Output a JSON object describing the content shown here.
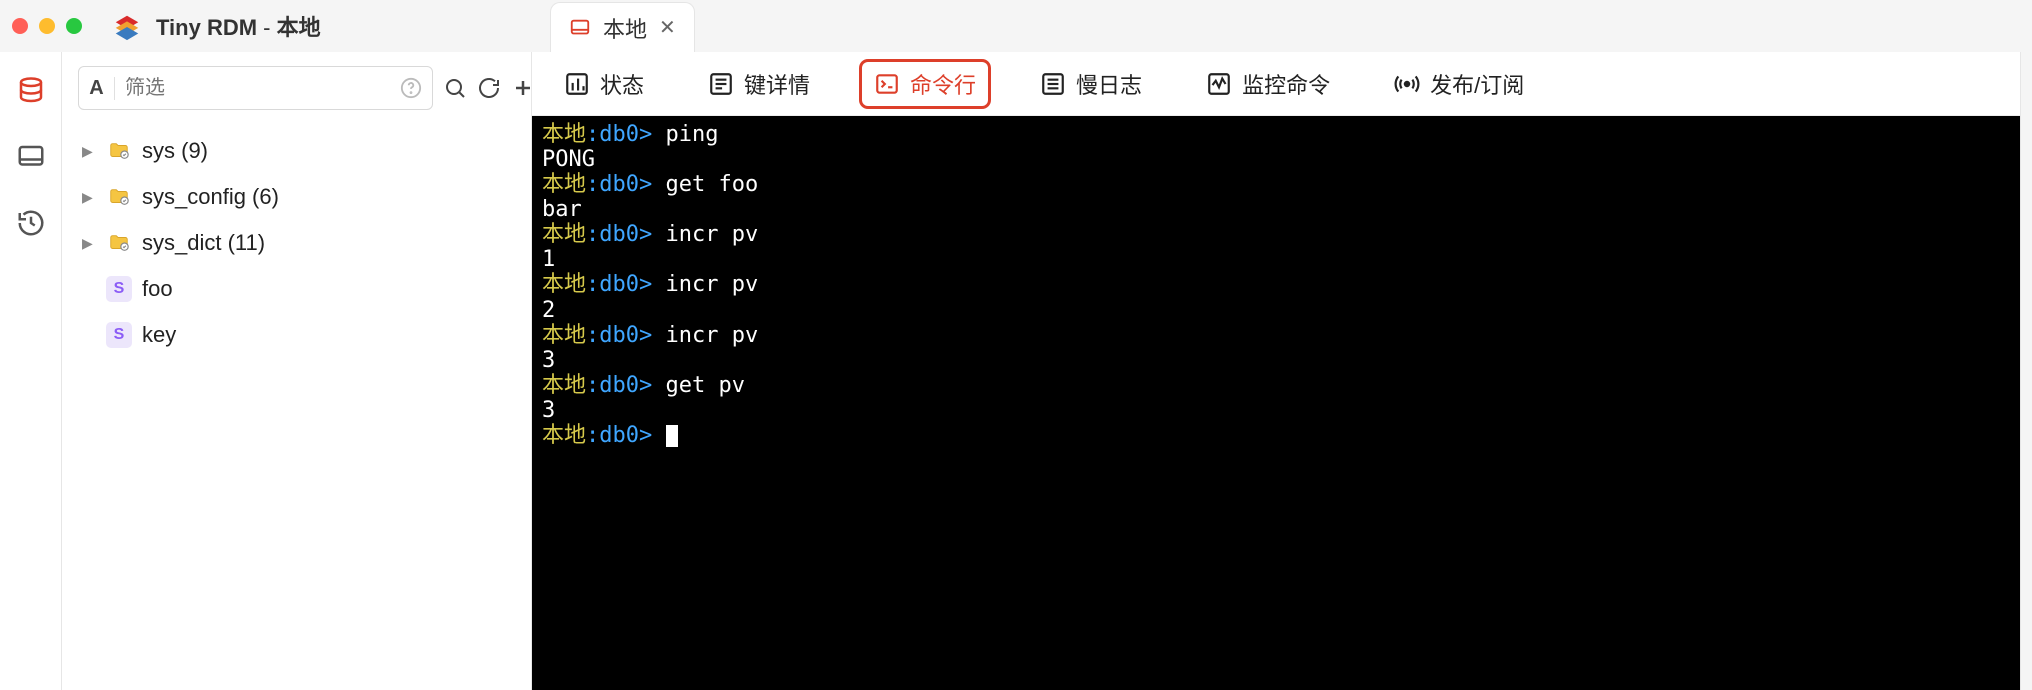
{
  "window": {
    "app_name": "Tiny RDM",
    "connection": "本地"
  },
  "tab": {
    "label": "本地"
  },
  "sidebar": {
    "mode_letter": "A",
    "filter_placeholder": "筛选",
    "tree": [
      {
        "type": "folder",
        "label": "sys (9)"
      },
      {
        "type": "folder",
        "label": "sys_config (6)"
      },
      {
        "type": "folder",
        "label": "sys_dict (11)"
      },
      {
        "type": "key",
        "badge": "S",
        "label": "foo"
      },
      {
        "type": "key",
        "badge": "S",
        "label": "key"
      }
    ]
  },
  "subtabs": {
    "status": "状态",
    "keydetail": "键详情",
    "cli": "命令行",
    "slowlog": "慢日志",
    "monitor": "监控命令",
    "pubsub": "发布/订阅"
  },
  "terminal": {
    "prompt_host": "本地",
    "prompt_db": "db0",
    "lines": [
      {
        "t": "cmd",
        "text": "ping"
      },
      {
        "t": "out",
        "text": "PONG"
      },
      {
        "t": "cmd",
        "text": "get foo"
      },
      {
        "t": "out",
        "text": "bar"
      },
      {
        "t": "cmd",
        "text": "incr pv"
      },
      {
        "t": "out",
        "text": "1"
      },
      {
        "t": "cmd",
        "text": "incr pv"
      },
      {
        "t": "out",
        "text": "2"
      },
      {
        "t": "cmd",
        "text": "incr pv"
      },
      {
        "t": "out",
        "text": "3"
      },
      {
        "t": "cmd",
        "text": "get pv"
      },
      {
        "t": "out",
        "text": "3"
      },
      {
        "t": "prompt",
        "text": ""
      }
    ]
  }
}
